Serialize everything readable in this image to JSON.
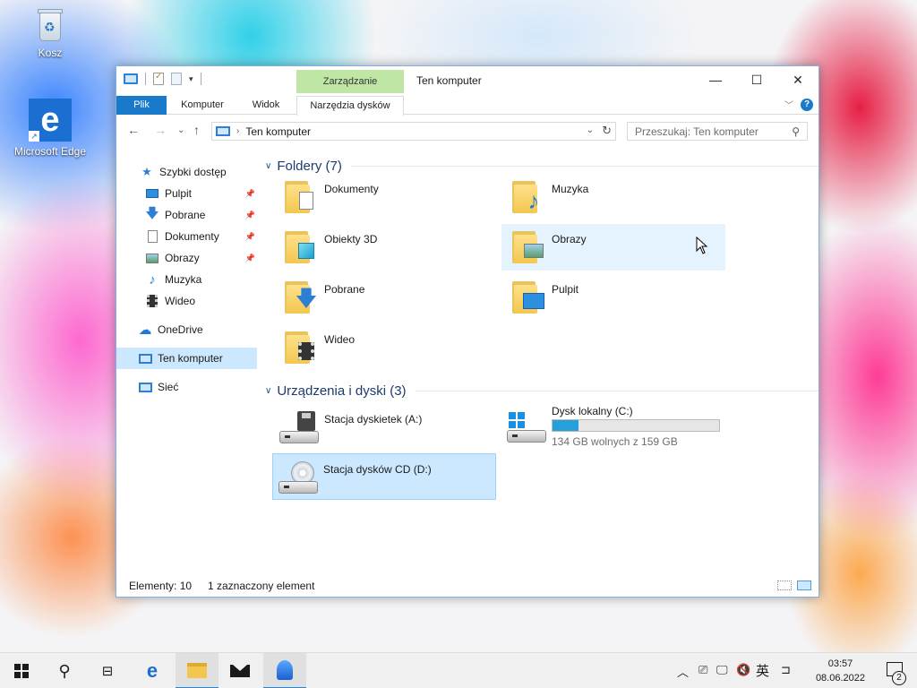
{
  "desktop": {
    "recycle_bin": "Kosz",
    "edge": "Microsoft Edge"
  },
  "window": {
    "title": "Ten komputer",
    "context_group": "Zarządzanie",
    "controls": {
      "minimize": "—",
      "maximize": "☐",
      "close": "✕"
    }
  },
  "ribbon": {
    "tabs": [
      "Plik",
      "Komputer",
      "Widok",
      "Narzędzia dysków"
    ]
  },
  "address": {
    "path": "Ten komputer",
    "search_placeholder": "Przeszukaj: Ten komputer"
  },
  "navpane": {
    "items": [
      {
        "label": "Szybki dostęp"
      },
      {
        "label": "Pulpit"
      },
      {
        "label": "Pobrane"
      },
      {
        "label": "Dokumenty"
      },
      {
        "label": "Obrazy"
      },
      {
        "label": "Muzyka"
      },
      {
        "label": "Wideo"
      },
      {
        "label": "OneDrive"
      },
      {
        "label": "Ten komputer"
      },
      {
        "label": "Sieć"
      }
    ]
  },
  "content": {
    "folders_header": "Foldery (7)",
    "folders": [
      {
        "name": "Dokumenty"
      },
      {
        "name": "Muzyka"
      },
      {
        "name": "Obiekty 3D"
      },
      {
        "name": "Obrazy"
      },
      {
        "name": "Pobrane"
      },
      {
        "name": "Pulpit"
      },
      {
        "name": "Wideo"
      }
    ],
    "devices_header": "Urządzenia i dyski (3)",
    "devices": [
      {
        "name": "Stacja dyskietek (A:)"
      },
      {
        "name": "Dysk lokalny (C:)",
        "free": "134 GB wolnych z 159 GB",
        "used_fraction": 0.157
      },
      {
        "name": "Stacja dysków CD (D:)"
      }
    ]
  },
  "status": {
    "items": "Elementy: 10",
    "selected": "1 zaznaczony element"
  },
  "taskbar": {
    "time": "03:57",
    "date": "08.06.2022",
    "ime": "英",
    "notifications": "2"
  },
  "colors": {
    "accent": "#1979ca",
    "context_tab": "#bfe6a4",
    "selection": "#cce8ff",
    "drive_bar": "#26a0da"
  }
}
